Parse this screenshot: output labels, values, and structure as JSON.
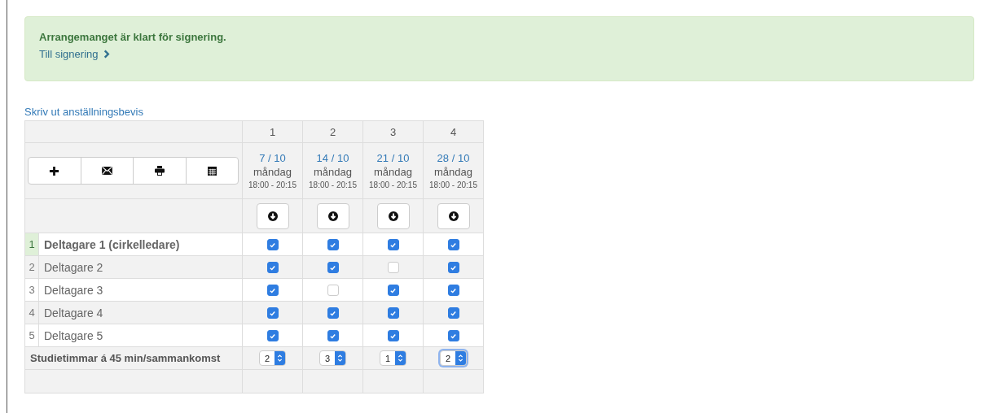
{
  "alert": {
    "message": "Arrangemanget är klart för signering.",
    "link": "Till signering"
  },
  "print_link": "Skriv ut anställningsbevis",
  "toolbar": [
    {
      "kind": "add"
    },
    {
      "kind": "mail"
    },
    {
      "kind": "print"
    },
    {
      "kind": "calendar"
    }
  ],
  "sessions": [
    {
      "number": "1",
      "date": "7 / 10",
      "weekday": "måndag",
      "time": "18:00 - 20:15",
      "hours": "2",
      "focused": false
    },
    {
      "number": "2",
      "date": "14 / 10",
      "weekday": "måndag",
      "time": "18:00 - 20:15",
      "hours": "3",
      "focused": false
    },
    {
      "number": "3",
      "date": "21 / 10",
      "weekday": "måndag",
      "time": "18:00 - 20:15",
      "hours": "1",
      "focused": false
    },
    {
      "number": "4",
      "date": "28 / 10",
      "weekday": "måndag",
      "time": "18:00 - 20:15",
      "hours": "2",
      "focused": true
    }
  ],
  "participants": [
    {
      "number": "1",
      "name": "Deltagare 1 (cirkelledare)",
      "leader": true,
      "attendance": [
        true,
        true,
        true,
        true
      ]
    },
    {
      "number": "2",
      "name": "Deltagare 2",
      "leader": false,
      "attendance": [
        true,
        true,
        false,
        true
      ]
    },
    {
      "number": "3",
      "name": "Deltagare 3",
      "leader": false,
      "attendance": [
        true,
        false,
        true,
        true
      ]
    },
    {
      "number": "4",
      "name": "Deltagare 4",
      "leader": false,
      "attendance": [
        true,
        true,
        true,
        true
      ]
    },
    {
      "number": "5",
      "name": "Deltagare 5",
      "leader": false,
      "attendance": [
        true,
        true,
        true,
        true
      ]
    }
  ],
  "hours_label": "Studietimmar á 45 min/sammankomst"
}
